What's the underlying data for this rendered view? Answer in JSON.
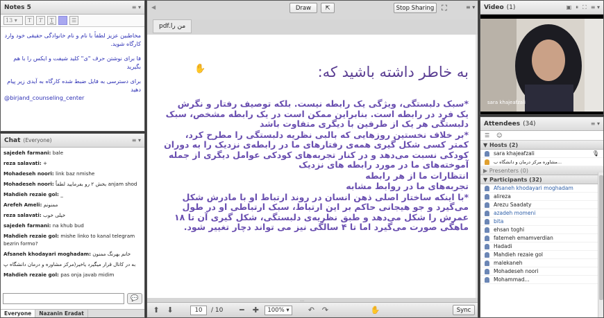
{
  "notes": {
    "title": "Notes 5",
    "menu": "≡ ▾",
    "font_size": "13 ▾",
    "paragraphs": [
      "مخاطبین عزیز لطفاً با نام و نام خانوادگی حقیقی خود وارد کارگاه شوید.",
      "فا برای نوشتن حرف \"ی\" کلید شیفت و ایکس را با هم بگیرید",
      "برای دسترسی به فایل ضبط شده کارگاه به آیدی زیر پیام دهید"
    ],
    "handle": "@birjand_counseling_center"
  },
  "chat": {
    "title": "Chat",
    "scope": "(Everyone)",
    "messages": [
      {
        "name": "sajedeh farmani:",
        "text": "bale"
      },
      {
        "name": "reza salavati:",
        "text": "+"
      },
      {
        "name": "Mohadeseh noori:",
        "text": "link baz nmishe"
      },
      {
        "name": "Mohadeseh noori:",
        "text": "بخش ۲ رو بفرمایید لطفاً anjam shod"
      },
      {
        "name": "Mahdieh rezaie gol:",
        "text": "_"
      },
      {
        "name": "Arefeh Ameli:",
        "text": "ممنونم"
      },
      {
        "name": "reza salavati:",
        "text": "خیلی خوب"
      },
      {
        "name": "sajedeh farmani:",
        "text": "na khub bud"
      },
      {
        "name": "Mahdieh rezaie gol:",
        "text": "mishe linko to kanal telegram bezrin formo?"
      },
      {
        "name": "Afsaneh khodayari moghadam:",
        "text": "خانم بهرنگ ممنون"
      },
      {
        "name": "",
        "text": "به در کانال قرار میگیرد یاخیر(مرکز مشاوره و درمان دانشگاه پ"
      },
      {
        "name": "Mahdieh rezaie gol:",
        "text": "pas onja javab midim"
      }
    ],
    "tabs": [
      "Everyone",
      "Nazanin Eradat"
    ]
  },
  "share": {
    "filename": "pdf.من را",
    "draw_label": "Draw",
    "stop_label": "Stop Sharing",
    "slide_title": "به خاطر داشته باشید که:",
    "slide_lines": [
      "*سبک دلبستگی، ویژگی یک رابطه نیست. بلکه توصیف رفتار و نگرش یک فرد در رابطه است. بنابراین ممکن است در یک رابطه مشخص، سبک دلبستگی هر یک از طرفین با دیگری متفاوت باشد",
      "*بر خلاف نخستین روزهایی که بالبی نظریه دلبستگی را مطرح کرد، کمتر کسی شکل گیری همه‌ی رفتارهای ما در رابطه‌ی نزدیک را به دوران کودکی نسبت می‌دهد و در کنار تجربه‌های کودکی عوامل دیگری از جمله آموخته‌های ما در مورد رابطه های نزدیک",
      "انتظارات ما از هر رابطه",
      "تجربه‌های ما در روابط مشابه",
      "*با اینکه ساختار اصلی ذهن انسان در روند ارتباط او با مادرش شکل می‌گیرد و جو هیجانی حاکم بر این ارتباط، سبک ارتباطی او در طول عمرش را شکل می‌دهد و طبق نظریه‌ی دلبستگی، شکل گیری آن تا ۱۸ ماهگی صورت می‌گیرد اما تا ۴ سالگی نیز می تواند دچار تغییر شود."
    ],
    "page_current": "10",
    "page_total": "/ 10",
    "zoom": "100%",
    "sync_label": "Sync"
  },
  "video": {
    "title": "Video",
    "count": "(1)",
    "person": "sara khajeafzali"
  },
  "attendees": {
    "title": "Attendees",
    "count": "(34)",
    "hosts_label": "Hosts (2)",
    "hosts": [
      "sara khajeafzali",
      "مشاوره مرکز درمان و دانشگاه ب..."
    ],
    "presenters_label": "Presenters (0)",
    "participants_label": "Participants (32)",
    "participants": [
      {
        "name": "Afsaneh khodayari moghadam",
        "blue": true
      },
      {
        "name": "alireza",
        "blue": false
      },
      {
        "name": "Arezu Saadaty",
        "blue": false
      },
      {
        "name": "azadeh momeni",
        "blue": true
      },
      {
        "name": "bita",
        "blue": true
      },
      {
        "name": "ehsan toghi",
        "blue": false
      },
      {
        "name": "fatemeh emamverdian",
        "blue": false
      },
      {
        "name": "Hadadi",
        "blue": false
      },
      {
        "name": "Mahdieh rezaie gol",
        "blue": false
      },
      {
        "name": "malekaneh",
        "blue": false
      },
      {
        "name": "Mohadeseh noori",
        "blue": false
      },
      {
        "name": "Mohammad...",
        "blue": false
      }
    ]
  },
  "colors": {
    "slide_text": "#6a4fb0",
    "notes_text": "#2c2fb5"
  }
}
